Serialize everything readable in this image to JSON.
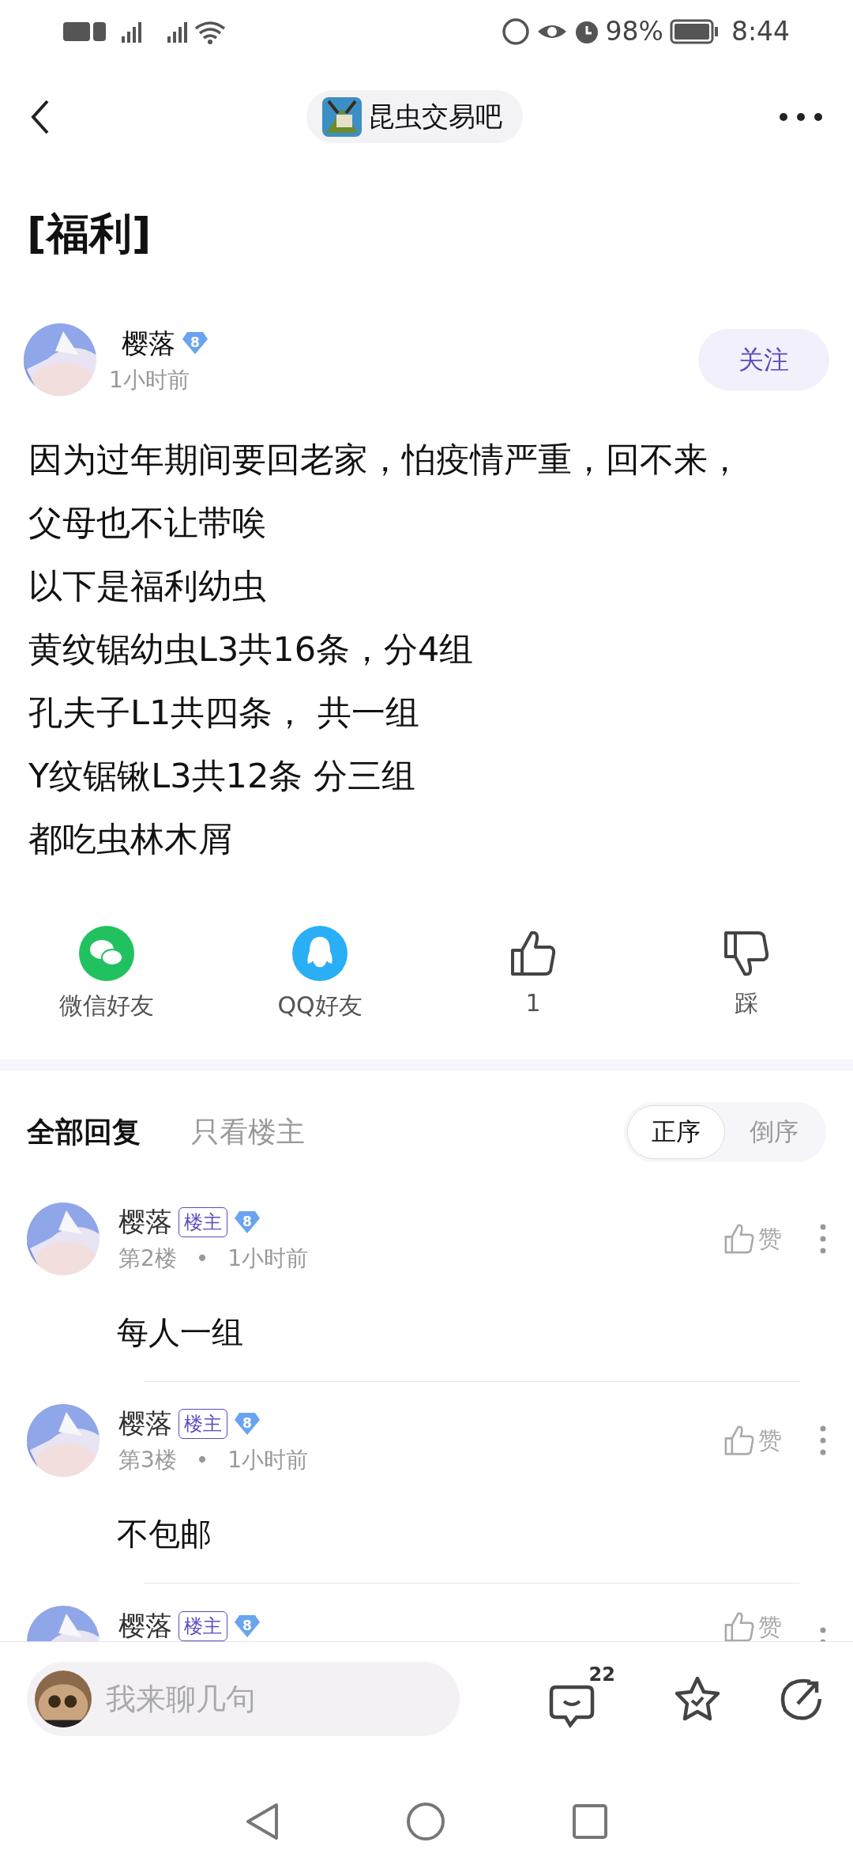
{
  "status_bar": {
    "battery": "98%",
    "time": "8:44"
  },
  "header": {
    "forum_name": "昆虫交易吧"
  },
  "post": {
    "title": "[福利]",
    "author": {
      "name": "樱落",
      "level": "8",
      "time": "1小时前"
    },
    "follow_button": "关注",
    "lines": [
      "因为过年期间要回老家，怕疫情严重，回不来，",
      "父母也不让带唉",
      "以下是福利幼虫",
      "黄纹锯幼虫L3共16条，分4组",
      "孔夫子L1共四条， 共一组",
      "Y纹锯锹L3共12条 分三组",
      "都吃虫林木屑"
    ]
  },
  "share_actions": [
    {
      "kind": "wechat",
      "label": "微信好友"
    },
    {
      "kind": "qq",
      "label": "QQ好友"
    },
    {
      "kind": "like",
      "label": "1"
    },
    {
      "kind": "dislike",
      "label": "踩"
    }
  ],
  "reply_tabs": [
    {
      "label": "全部回复",
      "selected": true
    },
    {
      "label": "只看楼主",
      "selected": false
    }
  ],
  "sort": [
    {
      "label": "正序",
      "selected": true
    },
    {
      "label": "倒序",
      "selected": false
    }
  ],
  "replies": [
    {
      "name": "樱落",
      "tag": "楼主",
      "level": "8",
      "floor": "第2楼",
      "separator": "•",
      "time": "1小时前",
      "like": "赞",
      "content": "每人一组"
    },
    {
      "name": "樱落",
      "tag": "楼主",
      "level": "8",
      "floor": "第3楼",
      "separator": "•",
      "time": "1小时前",
      "like": "赞",
      "content": "不包邮"
    },
    {
      "name": "樱落",
      "tag": "楼主",
      "level": "8",
      "like": "赞"
    }
  ],
  "bottom_bar": {
    "placeholder": "我来聊几句",
    "comment_count": "22"
  }
}
